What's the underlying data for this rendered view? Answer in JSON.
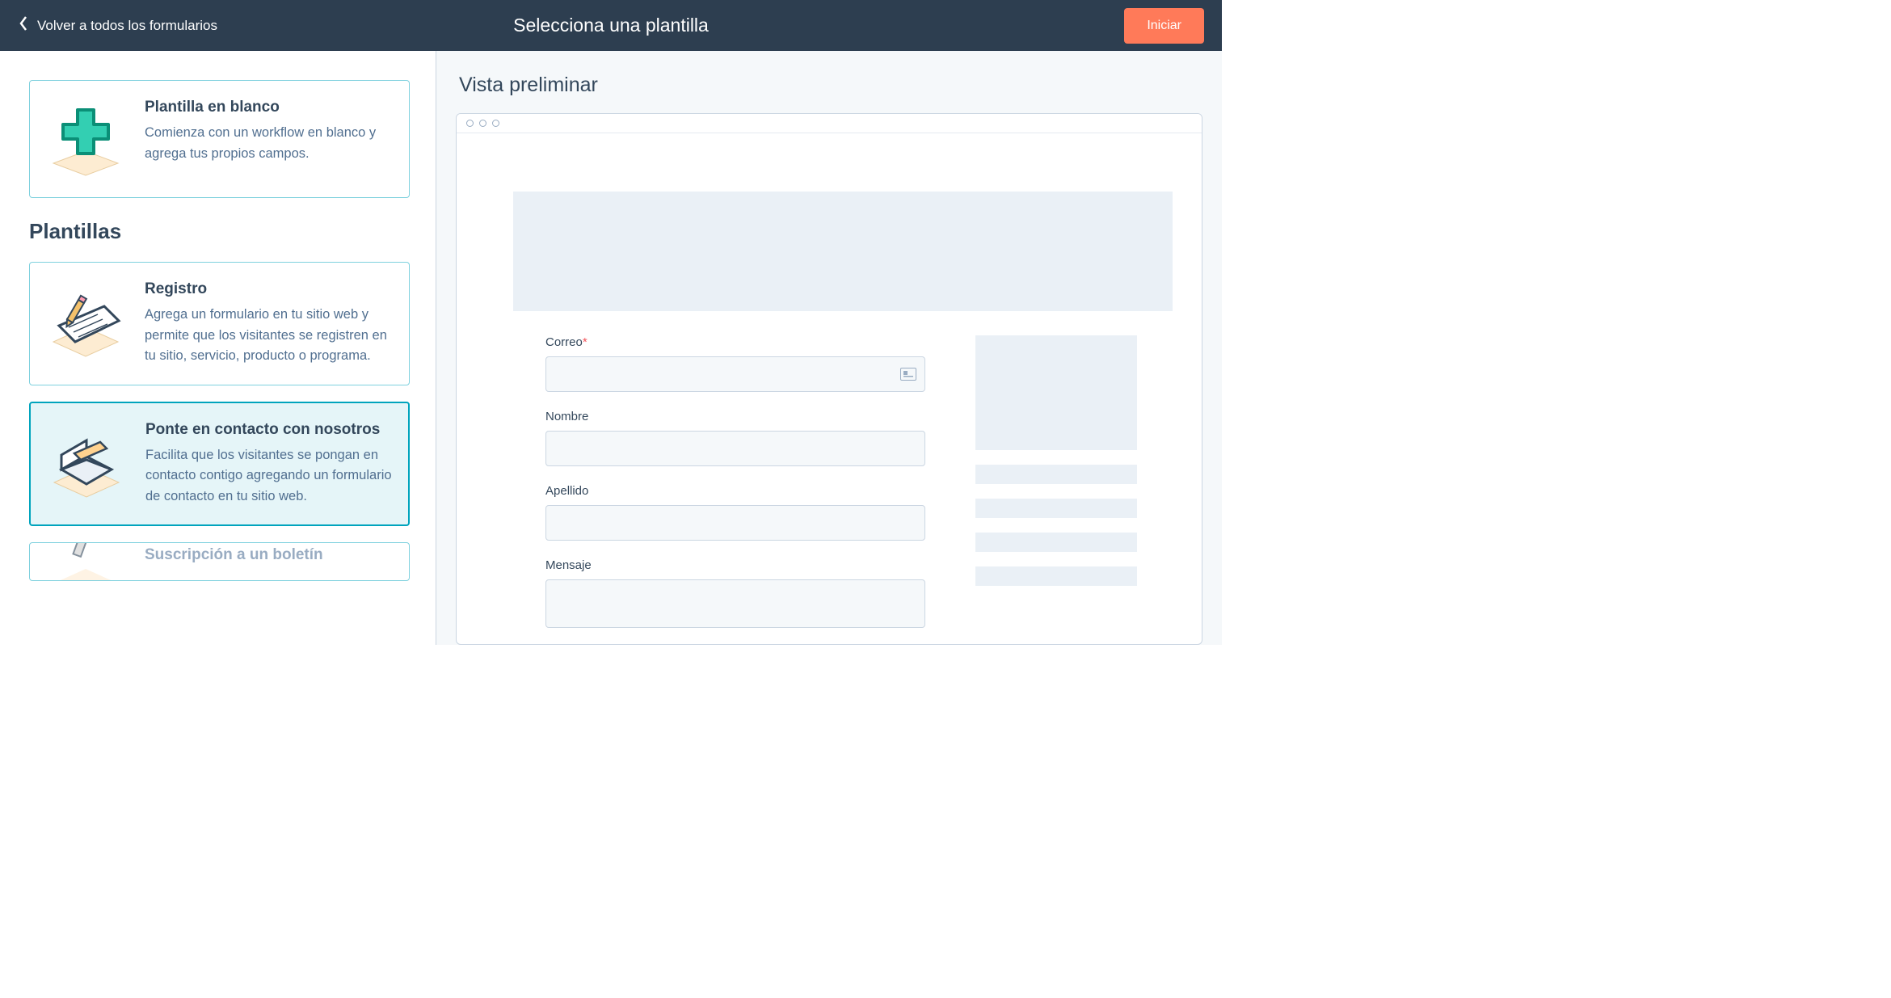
{
  "header": {
    "back_label": "Volver a todos los formularios",
    "title": "Selecciona una plantilla",
    "start_label": "Iniciar"
  },
  "left": {
    "blank": {
      "title": "Plantilla en blanco",
      "desc": "Comienza con un workflow en blanco y agrega tus propios campos."
    },
    "section_heading": "Plantillas",
    "templates": [
      {
        "title": "Registro",
        "desc": "Agrega un formulario en tu sitio web y permite que los visitantes se registren en tu sitio, servicio, producto o programa."
      },
      {
        "title": "Ponte en contacto con nosotros",
        "desc": "Facilita que los visitantes se pongan en contacto contigo agregando un formulario de contacto en tu sitio web."
      },
      {
        "title": "Suscripción a un boletín",
        "desc": ""
      }
    ]
  },
  "preview": {
    "heading": "Vista preliminar",
    "fields": {
      "email_label": "Correo",
      "firstname_label": "Nombre",
      "lastname_label": "Apellido",
      "message_label": "Mensaje"
    }
  }
}
